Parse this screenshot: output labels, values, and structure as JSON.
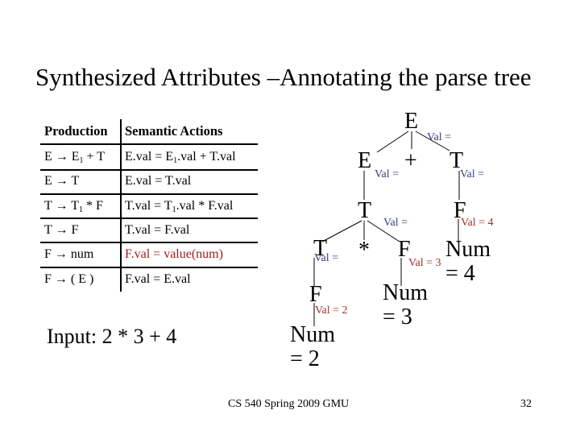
{
  "slide": {
    "title": "Synthesized Attributes –Annotating the parse tree",
    "footer": "CS 540 Spring 2009 GMU",
    "page_number": "32",
    "input_label": "Input: 2 * 3 + 4"
  },
  "table": {
    "headers": [
      "Production",
      "Semantic Actions"
    ],
    "rows": [
      {
        "production": [
          "E → E",
          "1",
          " + T"
        ],
        "action": [
          "E.val = E",
          "1",
          ".val + T.val"
        ],
        "highlight": false
      },
      {
        "production": [
          "E → T",
          "",
          ""
        ],
        "action": [
          "E.val = T.val",
          "",
          ""
        ],
        "highlight": false
      },
      {
        "production": [
          "T → T",
          "1",
          " * F"
        ],
        "action": [
          "T.val = T",
          "1",
          ".val * F.val"
        ],
        "highlight": false
      },
      {
        "production": [
          "T → F",
          "",
          ""
        ],
        "action": [
          "T.val = F.val",
          "",
          ""
        ],
        "highlight": false
      },
      {
        "production": [
          "F → num",
          "",
          ""
        ],
        "action": [
          "F.val = value(num)",
          "",
          ""
        ],
        "highlight": true
      },
      {
        "production": [
          "F → ( E )",
          "",
          ""
        ],
        "action": [
          "F.val = E.val",
          "",
          ""
        ],
        "highlight": false
      }
    ],
    "highlight_color": "#a01c1c"
  },
  "tree": {
    "nodes": {
      "root_E": "E",
      "left_E": "E",
      "plus": "+",
      "right_T": "T",
      "mid_T": "T",
      "right_F": "F",
      "leaf_T": "T",
      "star": "*",
      "mid_F": "F",
      "num4": "Num",
      "num4_val": "= 4",
      "leaf_F": "F",
      "num3": "Num",
      "num3_val": "= 3",
      "num2": "Num",
      "num2_val": "= 2"
    },
    "annotations": {
      "root_E": "Val =",
      "left_E": "Val =",
      "right_T": "Val =",
      "mid_T": "Val =",
      "right_F": "Val = 4",
      "leaf_T": "Val =",
      "mid_F": "Val = 3",
      "leaf_F": "Val = 2"
    },
    "colors": {
      "pending_annotation": "#3b3b7a",
      "computed_annotation": "#a03030"
    }
  }
}
